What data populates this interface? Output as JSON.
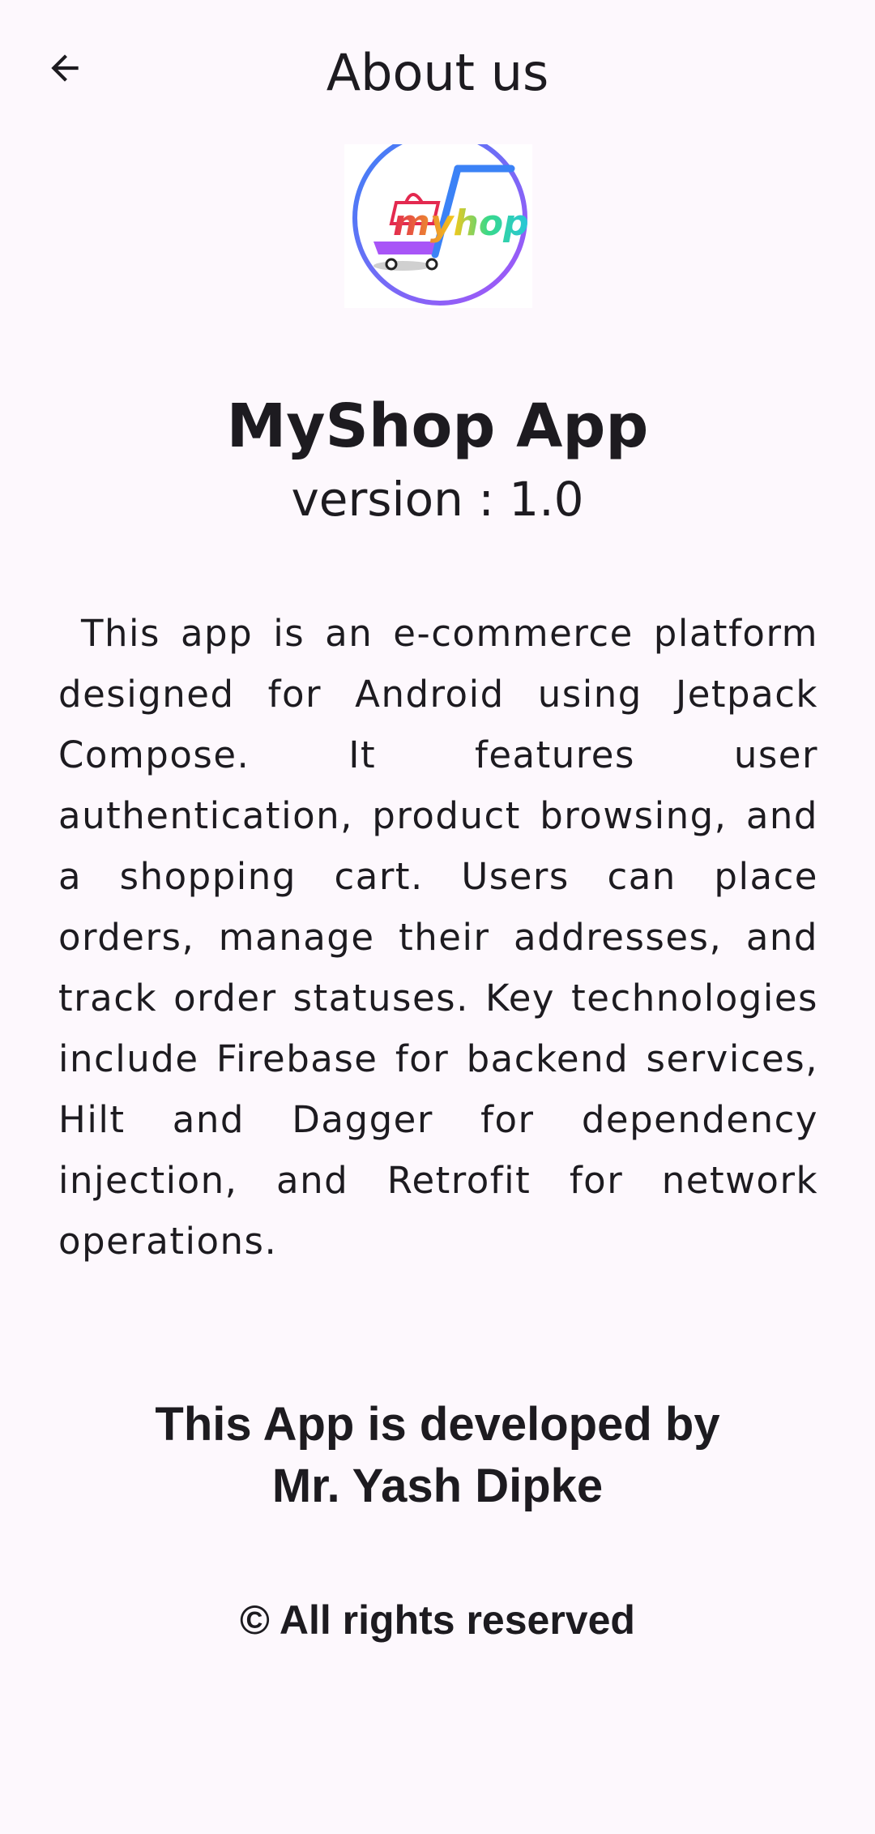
{
  "header": {
    "title": "About us",
    "back_icon": "arrow-back-icon"
  },
  "logo": {
    "text": "myhop",
    "icon": "shopping-cart-icon",
    "colors": {
      "ring": "#7d5ce6",
      "red": "#e3294f",
      "yellow": "#f2c81c",
      "green": "#39d98a",
      "cyan": "#26c6da",
      "blue": "#3b82f6"
    }
  },
  "app": {
    "name": "MyShop App",
    "version": "version : 1.0"
  },
  "description": "This app is an e-commerce platform designed for Android using Jetpack Compose. It features user authentication, product browsing, and a shopping cart. Users can place orders, manage their addresses, and track order statuses. Key technologies include Firebase for backend services, Hilt and Dagger for dependency injection, and Retrofit for network operations.",
  "developer": {
    "line1": "This App is developed by",
    "line2": "Mr. Yash Dipke"
  },
  "footer": {
    "rights": "© All rights reserved"
  },
  "theme": {
    "background": "#fdf8fd",
    "text": "#1d1b20"
  }
}
